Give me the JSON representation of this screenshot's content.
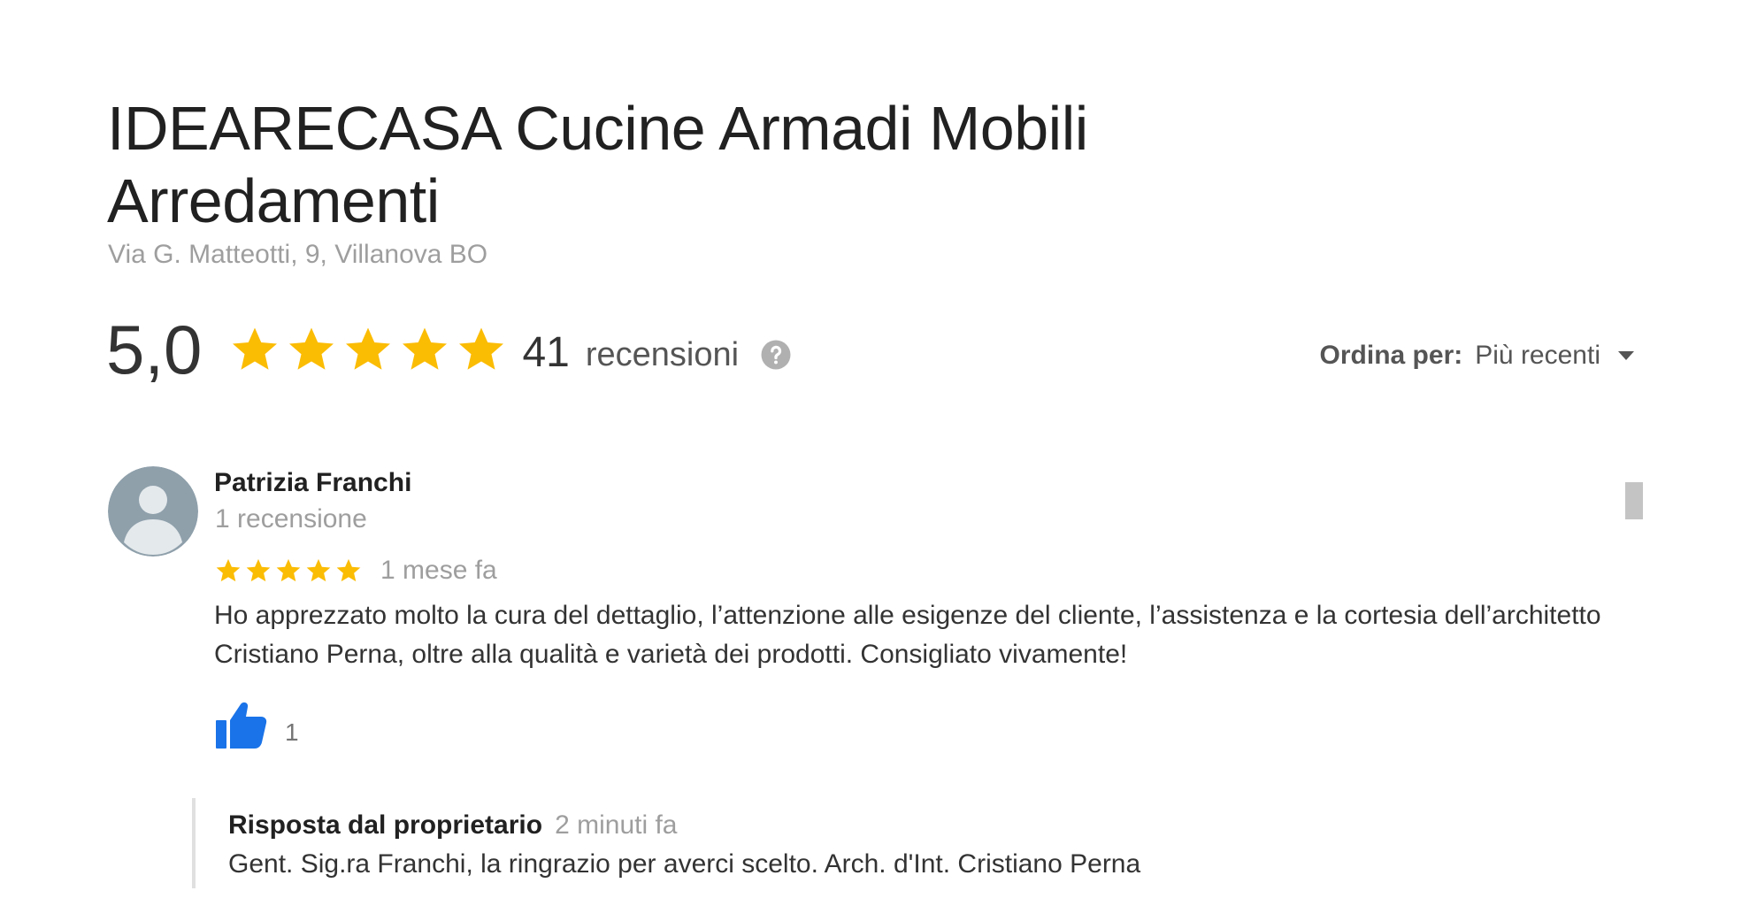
{
  "business": {
    "name": "IDEARECASA Cucine Armadi Mobili Arredamenti",
    "address": "Via G. Matteotti, 9, Villanova BO"
  },
  "rating": {
    "value": "5,0",
    "stars": 5,
    "count": "41",
    "count_label": "recensioni",
    "star_color": "#fbbc04"
  },
  "sort": {
    "label": "Ordina per:",
    "value": "Più recenti"
  },
  "review": {
    "author": "Patrizia Franchi",
    "author_meta": "1 recensione",
    "stars": 5,
    "date": "1 mese fa",
    "text": "Ho apprezzato molto la cura del dettaglio, l’attenzione alle esigenze del cliente, l’assistenza e la cortesia dell’architetto Cristiano Perna, oltre alla qualità e varietà dei prodotti. Consigliato vivamente!",
    "likes": "1",
    "like_color": "#1a73e8"
  },
  "owner_reply": {
    "title": "Risposta dal proprietario",
    "date": "2 minuti fa",
    "text": "Gent. Sig.ra Franchi, la ringrazio per averci scelto. Arch. d'Int. Cristiano Perna"
  }
}
